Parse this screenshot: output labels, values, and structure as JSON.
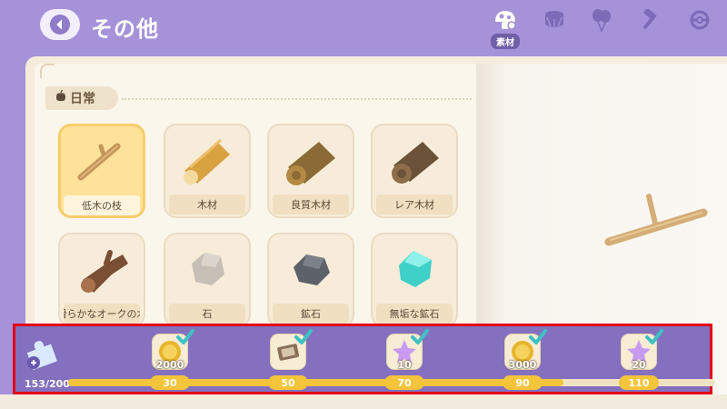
{
  "header": {
    "title": "その他",
    "active_tab_label": "素材",
    "tabs": [
      {
        "icon": "mushroom-icon",
        "label": "素材",
        "active": true
      },
      {
        "icon": "drum-icon",
        "active": false
      },
      {
        "icon": "balloons-icon",
        "active": false
      },
      {
        "icon": "hammer-icon",
        "active": false
      },
      {
        "icon": "pokeball-icon",
        "active": false
      }
    ]
  },
  "section": {
    "icon": "apple-icon",
    "label": "日常"
  },
  "items": [
    {
      "label": "低木の枝",
      "icon": "branch-icon",
      "selected": true
    },
    {
      "label": "木材",
      "icon": "lumber-icon",
      "selected": false
    },
    {
      "label": "良質木材",
      "icon": "quality-log-icon",
      "selected": false
    },
    {
      "label": "レア木材",
      "icon": "rare-log-icon",
      "selected": false
    },
    {
      "label": "滑らかなオークの木",
      "icon": "oak-wood-icon",
      "selected": false
    },
    {
      "label": "石",
      "icon": "stone-icon",
      "selected": false
    },
    {
      "label": "鉱石",
      "icon": "ore-icon",
      "selected": false
    },
    {
      "label": "無垢な鉱石",
      "icon": "pure-ore-icon",
      "selected": false
    }
  ],
  "preview": {
    "icon": "branch-preview-icon"
  },
  "rewards": {
    "progress_text": "153/200",
    "progress_value": 153,
    "progress_max": 200,
    "milestones": [
      {
        "threshold": "30",
        "amount": "2000",
        "icon": "gold-coin-icon",
        "claimed": true
      },
      {
        "threshold": "50",
        "amount": "",
        "icon": "photo-frame-icon",
        "claimed": true
      },
      {
        "threshold": "70",
        "amount": "10",
        "icon": "purple-star-icon",
        "claimed": true
      },
      {
        "threshold": "90",
        "amount": "3000",
        "icon": "gold-coin-icon",
        "claimed": true
      },
      {
        "threshold": "110",
        "amount": "20",
        "icon": "purple-star-icon",
        "claimed": true
      }
    ]
  },
  "colors": {
    "accent": "#8470bf",
    "highlight_border": "#e40014",
    "progress": "#f4c43a",
    "check": "#3fc1c4"
  }
}
